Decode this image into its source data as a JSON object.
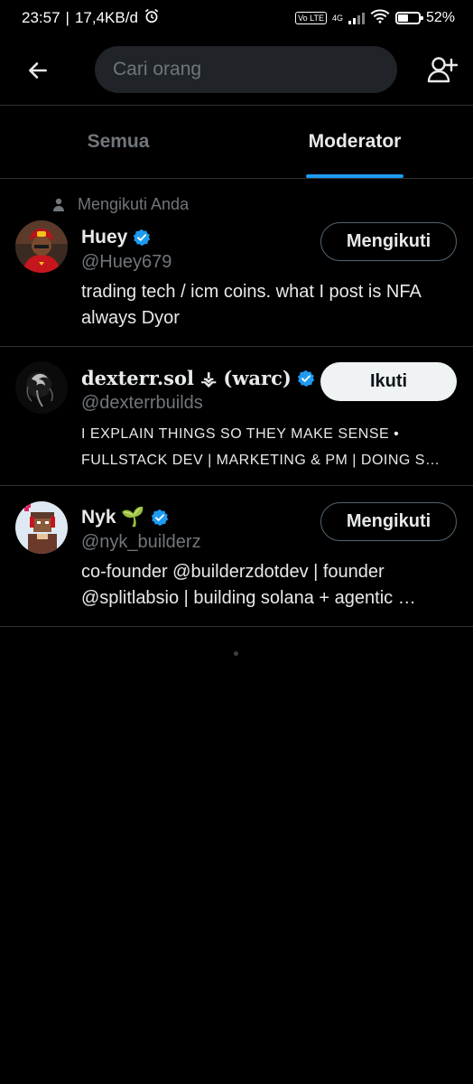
{
  "status_bar": {
    "time": "23:57",
    "net_speed": "17,4KB/d",
    "volte": "Vo LTE",
    "network": "4G",
    "battery_pct": "52%",
    "battery_level": 0.52
  },
  "header": {
    "search_placeholder": "Cari orang"
  },
  "tabs": [
    {
      "label": "Semua",
      "active": false
    },
    {
      "label": "Moderator",
      "active": true
    }
  ],
  "users": [
    {
      "context": "Mengikuti Anda",
      "name": "Huey",
      "handle": "@Huey679",
      "bio": "trading tech / icm coins. what I post is NFA always Dyor",
      "button": "Mengikuti"
    },
    {
      "name": "dexterr.sol ⚶ (warc)",
      "handle": "@dexterrbuilds",
      "bio": "I EXPLAIN THINGS SO THEY MAKE SENSE • FULLSTACK DEV | MARKETING & PM | DOING S…",
      "button": "Ikuti"
    },
    {
      "name": "Nyk 🌱",
      "handle": "@nyk_builderz",
      "bio": "co-founder @builderzdotdev | founder @splitlabsio | building solana + agentic …",
      "button": "Mengikuti"
    }
  ],
  "colors": {
    "accent": "#1d9bf0",
    "background": "#000000",
    "muted": "#71767b",
    "divider": "#2f3336"
  }
}
